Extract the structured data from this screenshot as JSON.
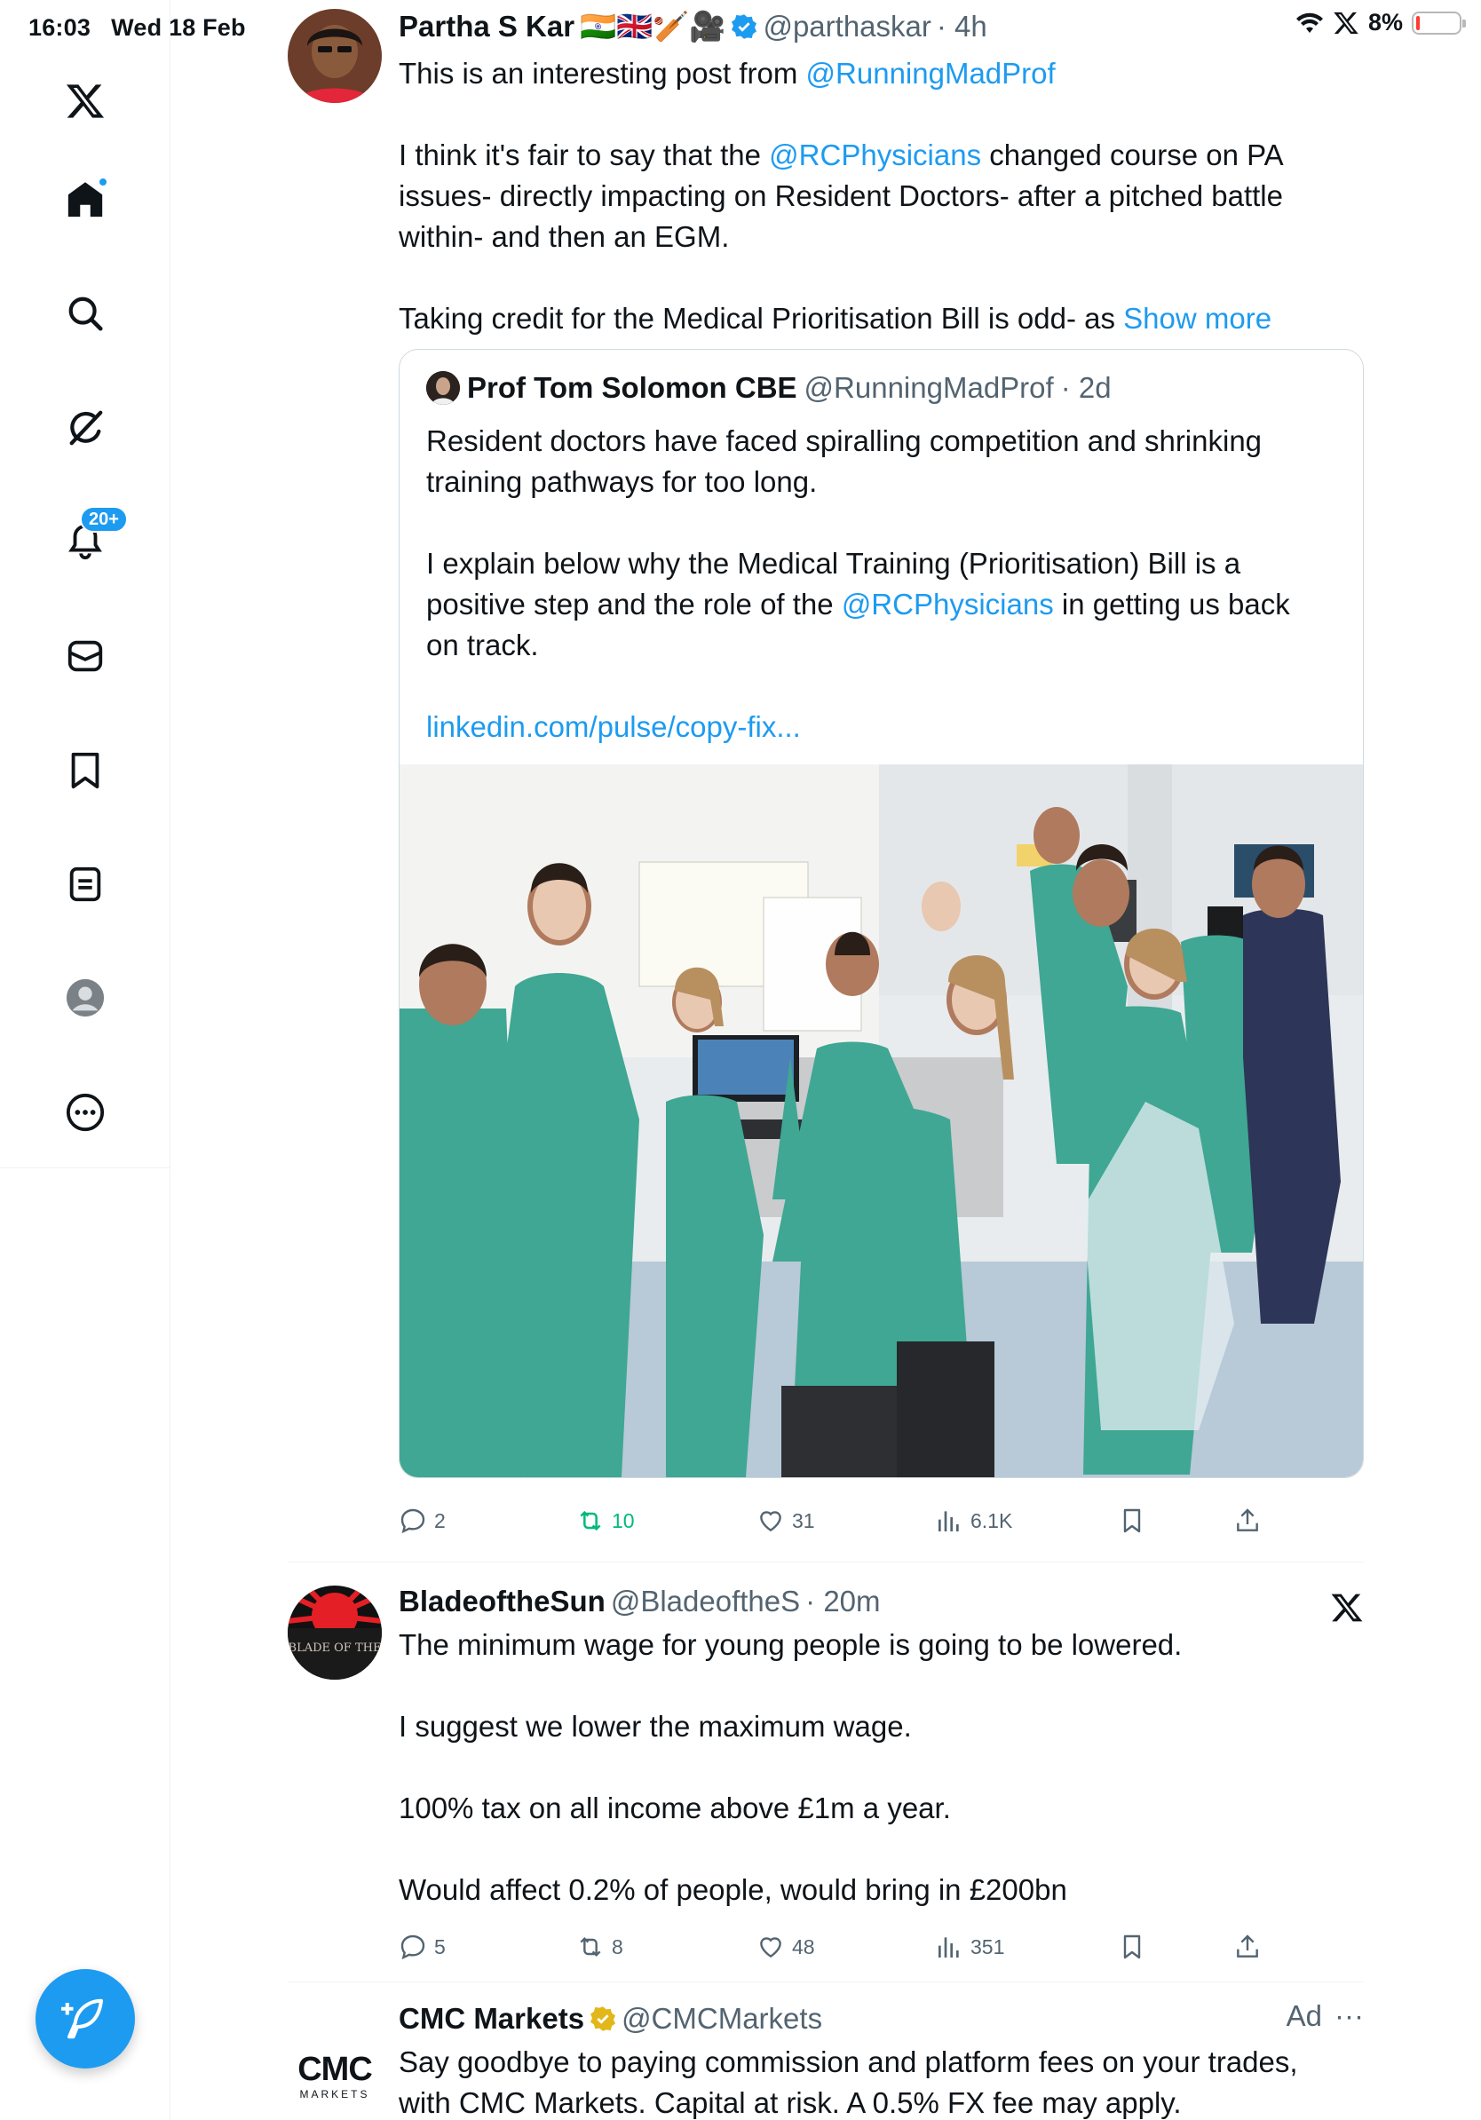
{
  "status_bar": {
    "time": "16:03",
    "date": "Wed 18 Feb",
    "battery": "8%",
    "battery_level": 0.08
  },
  "sidebar": {
    "items": [
      {
        "name": "home",
        "label": ""
      },
      {
        "name": "search",
        "label": ""
      },
      {
        "name": "grok",
        "label": ""
      },
      {
        "name": "notifications",
        "badge": "20+"
      },
      {
        "name": "messages"
      },
      {
        "name": "bookmarks"
      },
      {
        "name": "lists"
      },
      {
        "name": "profile"
      },
      {
        "name": "more"
      }
    ]
  },
  "tweets": [
    {
      "name": "Partha S Kar",
      "flags": "🇮🇳🇬🇧🏏🎥",
      "handle": "@parthaskar",
      "time": "· 4h",
      "lines": [
        [
          "This is an interesting post from ",
          "@RunningMadProf"
        ],
        [
          "I think it's fair to say that the ",
          "@RCPhysicians",
          " changed course on PA"
        ],
        [
          "issues- directly impacting on Resident Doctors- after a pitched battle"
        ],
        [
          "within- and then an EGM."
        ],
        [
          "Taking credit for the Medical Prioritisation Bill is odd- as ",
          "Show more"
        ]
      ],
      "quote": {
        "name": "Prof Tom Solomon CBE",
        "handle": "@RunningMadProf",
        "time": "· 2d",
        "line1": "Resident doctors have faced spiralling competition and shrinking",
        "line2": "training pathways for too long.",
        "line3": "I explain below why the Medical Training (Prioritisation) Bill is a",
        "line4a": "positive step and the role of the ",
        "line4b": "@RCPhysicians",
        "line4c": " in getting us back",
        "line5": "on track.",
        "link": "linkedin.com/pulse/copy-fix..."
      },
      "stats": {
        "replies": "2",
        "retweets": "10",
        "likes": "31",
        "views": "6.1K"
      }
    },
    {
      "name": "BladeoftheSun",
      "handle": "@BladeoftheS",
      "time": "· 20m",
      "line1": "The minimum wage for young people is going to be lowered.",
      "line2": "I suggest we lower the maximum wage.",
      "line3": "100% tax on all income above £1m a year.",
      "line4": "Would affect 0.2% of people, would bring in £200bn",
      "avatar_text": "BLADE OF THE",
      "stats": {
        "replies": "5",
        "retweets": "8",
        "likes": "48",
        "views": "351"
      }
    },
    {
      "name": "CMC Markets",
      "handle": "@CMCMarkets",
      "ad": "Ad",
      "more": "···",
      "logo_top": "CMC",
      "logo_bottom": "MARKETS",
      "line1": "Say goodbye to paying commission and platform fees on your trades,",
      "line2": "with CMC Markets. Capital at risk. A 0.5% FX fee may apply."
    }
  ],
  "colors": {
    "accent": "#1d9bf0",
    "retweet": "#00ba7c",
    "muted": "#536471",
    "verified_gold": "#e2b719"
  }
}
